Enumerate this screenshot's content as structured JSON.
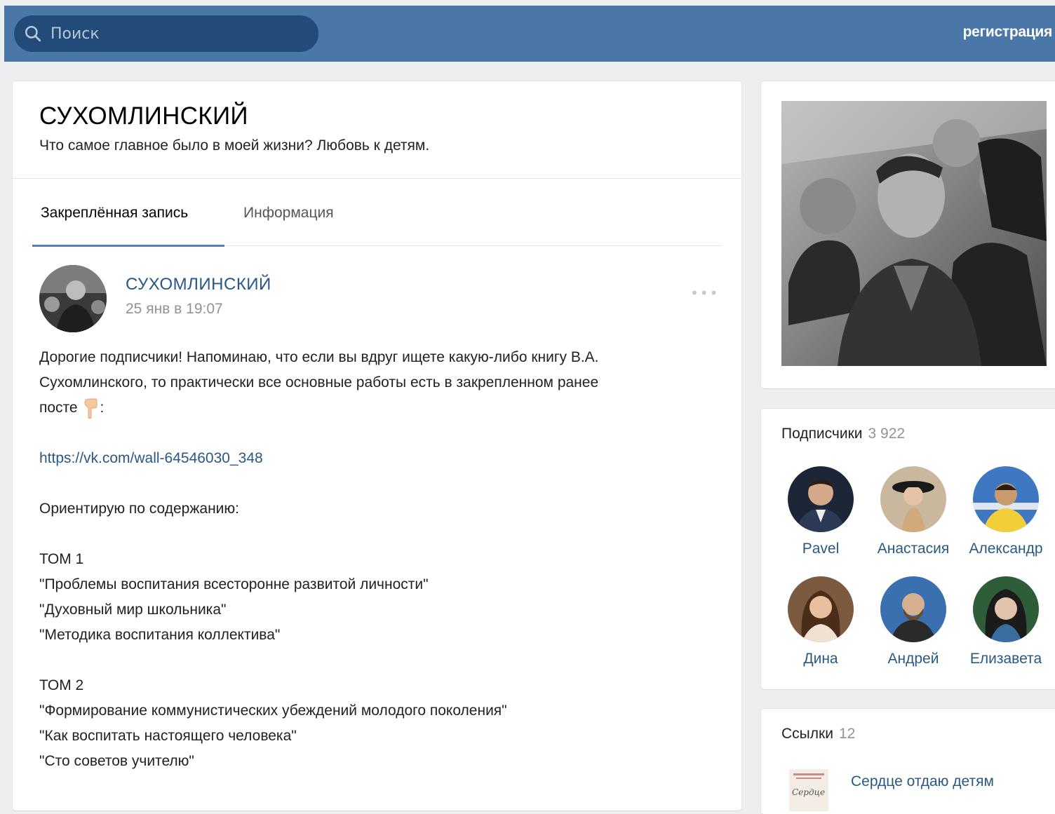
{
  "header": {
    "search_placeholder": "Поиск",
    "register_label": "регистрация"
  },
  "page": {
    "title": "СУХОМЛИНСКИЙ",
    "status": "Что самое главное было в моей жизни? Любовь к детям."
  },
  "tabs": [
    {
      "label": "Закреплённая запись",
      "active": true
    },
    {
      "label": "Информация",
      "active": false
    }
  ],
  "post": {
    "author": "СУХОМЛИНСКИЙ",
    "date": "25 янв в 19:07",
    "menu_glyph": "•••",
    "intro_1": "Дорогие подписчики! Напоминаю, что если вы вдруг ищете какую-либо книгу В.А.",
    "intro_2": "Сухомлинского, то практически все основные работы есть в закрепленном ранее",
    "intro_3_start": "посте",
    "intro_3_end": ":",
    "link": "https://vk.com/wall-64546030_348",
    "guide": "Ориентирую по содержанию:",
    "volume1": {
      "title": "ТОМ 1",
      "works": [
        "\"Проблемы воспитания всесторонне развитой личности\"",
        "\"Духовный мир школьника\"",
        "\"Методика воспитания коллектива\""
      ]
    },
    "volume2": {
      "title": "ТОМ 2",
      "works": [
        "\"Формирование коммунистических убеждений молодого поколения\"",
        "\"Как воспитать настоящего человека\"",
        "\"Сто советов учителю\""
      ]
    }
  },
  "subscribers": {
    "title": "Подписчики",
    "count": "3 922",
    "members": [
      {
        "name": "Pavel"
      },
      {
        "name": "Анастасия"
      },
      {
        "name": "Александр"
      },
      {
        "name": "Дина"
      },
      {
        "name": "Андрей"
      },
      {
        "name": "Елизавета"
      }
    ]
  },
  "links": {
    "title": "Ссылки",
    "count": "12",
    "items": [
      {
        "title": "Сердце отдаю детям",
        "thumb_text": "Сердце"
      }
    ]
  }
}
